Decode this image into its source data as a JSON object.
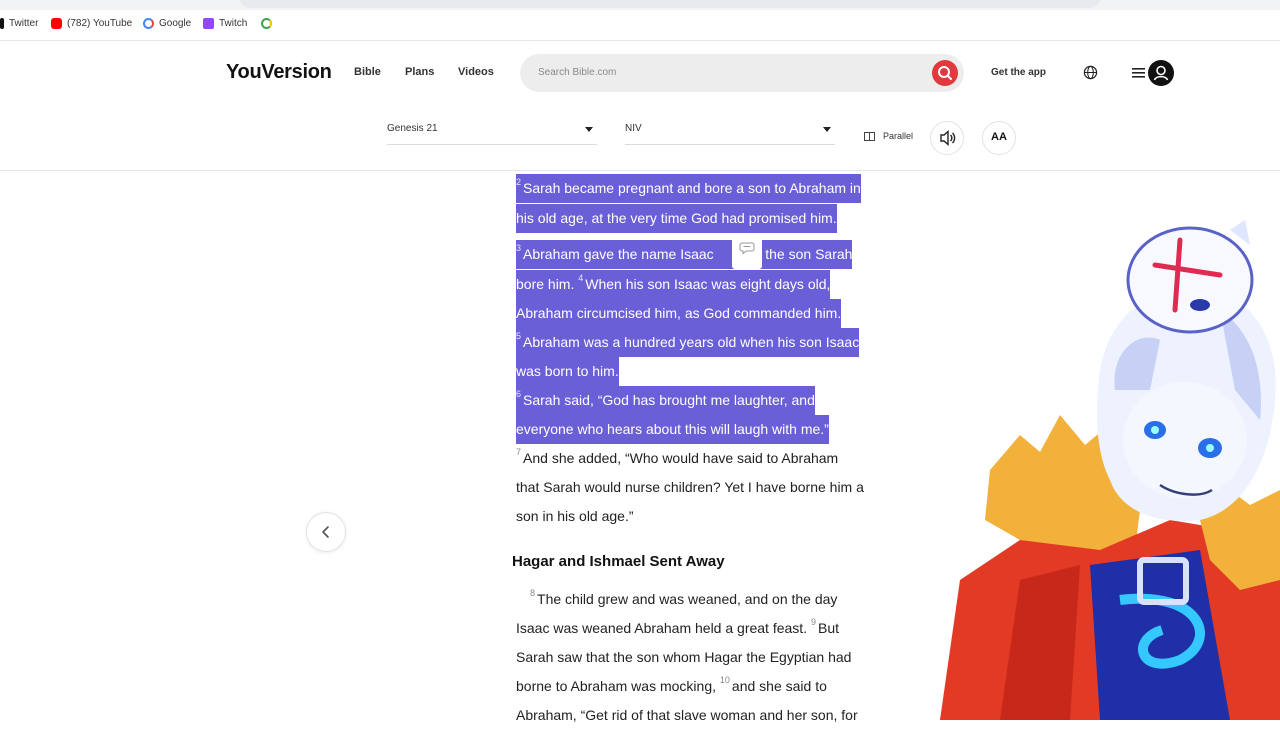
{
  "browser": {
    "bookmarks": [
      {
        "label": "Twitter",
        "icon": "twitter-icon",
        "color": "#111111"
      },
      {
        "label": "(782) YouTube",
        "icon": "youtube-icon",
        "color": "#ff0000"
      },
      {
        "label": "Google",
        "icon": "google-icon",
        "color": "#4285f4"
      },
      {
        "label": "Twitch",
        "icon": "twitch-icon",
        "color": "#9146ff"
      },
      {
        "label": "",
        "icon": "google-icon",
        "color": "#4285f4"
      }
    ]
  },
  "header": {
    "logo": "YouVersion",
    "nav": [
      "Bible",
      "Plans",
      "Videos"
    ],
    "search_placeholder": "Search Bible.com",
    "get_app": "Get the app",
    "accent": "#e0393e"
  },
  "toolbar": {
    "chapter": "Genesis 21",
    "version": "NIV",
    "parallel": "Parallel",
    "font_size": "AA"
  },
  "reader": {
    "highlight_color": "#6a5fd6",
    "lines": [
      {
        "segments": [
          {
            "sup": "2",
            "text": "Sarah became pregnant and bore a son to Abraham in"
          }
        ],
        "highlighted": true
      },
      {
        "segments": [
          {
            "sup": "",
            "text": "his old age, at the very time God had promised him."
          }
        ],
        "highlighted": true
      },
      {
        "segments": [
          {
            "sup": "3",
            "text": "Abraham gave the name Isaac"
          },
          {
            "sup": "",
            "text": "to the son Sarah"
          }
        ],
        "highlighted": true
      },
      {
        "segments": [
          {
            "sup": "",
            "text": "bore him. "
          },
          {
            "sup": "4",
            "text": "When his son Isaac was eight days old,"
          }
        ],
        "highlighted": true
      },
      {
        "segments": [
          {
            "sup": "",
            "text": "Abraham circumcised him, as God commanded him."
          }
        ],
        "highlighted": true
      },
      {
        "segments": [
          {
            "sup": "5",
            "text": "Abraham was a hundred years old when his son Isaac"
          }
        ],
        "highlighted": true
      },
      {
        "segments": [
          {
            "sup": "",
            "text": "was born to him."
          }
        ],
        "highlighted": true
      },
      {
        "segments": [
          {
            "sup": "6",
            "text": "Sarah said, “God has brought me laughter, and"
          }
        ],
        "highlighted": true
      },
      {
        "segments": [
          {
            "sup": "",
            "text": "everyone who hears about this will laugh with me.”"
          }
        ],
        "highlighted": true
      },
      {
        "segments": [
          {
            "sup": "7",
            "text": "And she added, “Who would have said to Abraham"
          }
        ],
        "highlighted": false
      },
      {
        "segments": [
          {
            "sup": "",
            "text": "that Sarah would nurse children? Yet I have borne him a"
          }
        ],
        "highlighted": false
      },
      {
        "segments": [
          {
            "sup": "",
            "text": "son in his old age.”"
          }
        ],
        "highlighted": false
      }
    ],
    "section_heading": "Hagar and Ishmael Sent Away",
    "lines2": [
      {
        "segments": [
          {
            "sup": "8",
            "text": "The child grew and was weaned, and on the day"
          }
        ]
      },
      {
        "segments": [
          {
            "sup": "",
            "text": "Isaac was weaned Abraham held a great feast. "
          },
          {
            "sup": "9",
            "text": "But"
          }
        ]
      },
      {
        "segments": [
          {
            "sup": "",
            "text": "Sarah saw that the son whom Hagar the Egyptian had"
          }
        ]
      },
      {
        "segments": [
          {
            "sup": "",
            "text": "borne to Abraham was mocking, "
          },
          {
            "sup": "10",
            "text": "and she said to"
          }
        ]
      },
      {
        "segments": [
          {
            "sup": "",
            "text": "Abraham, “Get rid of that slave woman and her son, for"
          }
        ]
      }
    ]
  }
}
